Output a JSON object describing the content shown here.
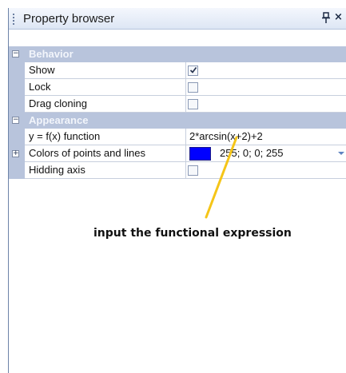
{
  "panel": {
    "title": "Property browser",
    "pin_icon": "pin-icon",
    "close_icon": "close-icon",
    "close_glyph": "×"
  },
  "categories": [
    {
      "label": "Behavior",
      "expander": "−",
      "properties": [
        {
          "name": "Show",
          "type": "checkbox",
          "checked": true
        },
        {
          "name": "Lock",
          "type": "checkbox",
          "checked": false
        },
        {
          "name": "Drag cloning",
          "type": "checkbox",
          "checked": false
        }
      ]
    },
    {
      "label": "Appearance",
      "expander": "−",
      "properties": [
        {
          "name": "y = f(x) function",
          "type": "text",
          "value": "2*arcsin(x+2)+2"
        },
        {
          "name": "Colors of points and lines",
          "type": "color",
          "expander": "+",
          "value": "255; 0; 0; 255",
          "swatch_color": "#0000ff"
        },
        {
          "name": "Hidding axis",
          "type": "checkbox",
          "checked": false
        }
      ]
    }
  ],
  "annotation": {
    "text": "input the functional expression",
    "arrow_color": "#f5c518"
  },
  "colors": {
    "category_bg": "#b8c4dc",
    "grid_line": "#c7cfdd",
    "title_gradient_top": "#f4f7fd",
    "title_gradient_bottom": "#dde6f4"
  }
}
